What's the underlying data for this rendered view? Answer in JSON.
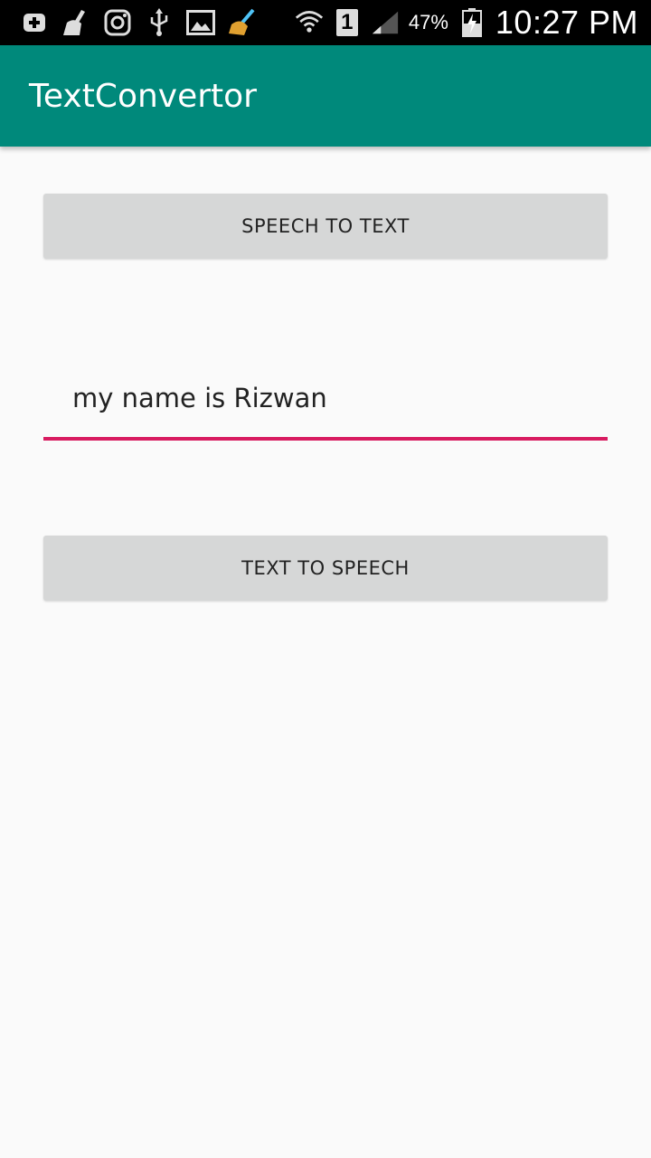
{
  "status_bar": {
    "left_icons": [
      "add-box-icon",
      "broom-icon",
      "instagram-icon",
      "usb-icon",
      "image-icon",
      "cleaner-broom-icon"
    ],
    "battery_percent": "47%",
    "sim_label": "1",
    "time": "10:27 PM"
  },
  "app_bar": {
    "title": "TextConvertor",
    "color": "#00897b"
  },
  "main": {
    "speech_to_text_label": "SPEECH TO TEXT",
    "text_input_value": "my name is Rizwan",
    "text_to_speech_label": "TEXT TO SPEECH",
    "accent_color": "#d81b60"
  }
}
